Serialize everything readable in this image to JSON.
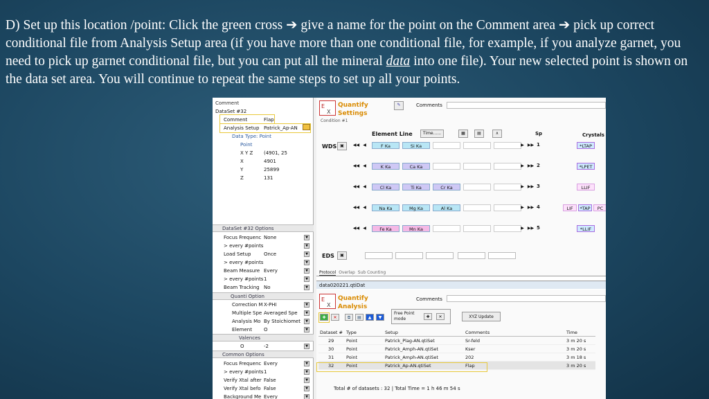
{
  "slide": {
    "text_a": "D) Set up this location /point:  Click the green cross ",
    "arrow1": "➔",
    "text_b": " give a name for the point on the Comment area ",
    "arrow2": "➔",
    "text_c": " pick up correct conditional file  from Analysis Setup area (if you have more than one conditional file, for example, if you analyze garnet, you need to pick up garnet conditional file, but you can put all the mineral ",
    "data_word": "data",
    "text_d": " into one file). Your new selected point is shown on the data set area.  You will continue to repeat the same steps to set up all your points."
  },
  "tree": {
    "comment_header": "Comment",
    "dataset": "DataSet #32",
    "comment_label": "Comment",
    "comment_value": "Flap",
    "analysis_label": "Analysis Setup",
    "analysis_value": "Patrick_Ap-AN",
    "data_type": "Data Type: Point",
    "point": "Point",
    "xyz_label": "X Y Z",
    "xyz_value": "(4901, 25",
    "x_label": "X",
    "x_value": "4901",
    "y_label": "Y",
    "y_value": "25899",
    "z_label": "Z",
    "z_value": "131"
  },
  "options": {
    "header": "DataSet #32 Options",
    "rows": [
      {
        "k": "Focus Frequenc",
        "v": "None"
      },
      {
        "k": "> every #points",
        "v": ""
      },
      {
        "k": "Load Setup",
        "v": "Once"
      },
      {
        "k": "> every #points",
        "v": ""
      },
      {
        "k": "Beam Measure",
        "v": "Every"
      },
      {
        "k": "> every #points",
        "v": "1"
      },
      {
        "k": "Beam Tracking",
        "v": "No"
      }
    ],
    "quanti_header": "Quanti  Option",
    "quanti_rows": [
      {
        "k": "Correction M",
        "v": "X-PHI"
      },
      {
        "k": "Multiple Spe",
        "v": "Averaged Spe"
      },
      {
        "k": "Analysis Mo",
        "v": "By Stoichiomet"
      },
      {
        "k": "Element",
        "v": "O"
      }
    ],
    "valence_header": "Valences",
    "valence_row": {
      "k": "O",
      "v": "-2"
    },
    "common_header": "Common Options",
    "common_rows": [
      {
        "k": "Focus Frequenc",
        "v": "Every"
      },
      {
        "k": "> every #points",
        "v": "1"
      },
      {
        "k": "Verify Xtal after",
        "v": "False"
      },
      {
        "k": "Verify Xtal befo",
        "v": "False"
      },
      {
        "k": "Background Me",
        "v": "Every"
      }
    ]
  },
  "quantify": {
    "title1": "Quantify",
    "title2": "Settings",
    "comments_label": "Comments",
    "condition": "Condition #1",
    "element_line": "Element Line",
    "time_btn": "Time......",
    "sp_label": "Sp",
    "crystals_label": "Crystals",
    "wds_label": "WDS",
    "eds_label": "EDS",
    "rows": [
      {
        "sp": "1",
        "els": [
          "F Ka",
          "Si Ka"
        ],
        "crystals": [
          "*LTAP"
        ]
      },
      {
        "sp": "2",
        "els": [
          "K Ka",
          "Ca Ka"
        ],
        "crystals": [
          "*LPET"
        ]
      },
      {
        "sp": "3",
        "els": [
          "Cl Ka",
          "Ti Ka",
          "Cr Ka"
        ],
        "crystals": [
          "LLIF"
        ]
      },
      {
        "sp": "4",
        "els": [
          "Na Ka",
          "Mg Ka",
          "Al Ka"
        ],
        "crystals": [
          "LIF",
          "*TAP",
          "PC"
        ]
      },
      {
        "sp": "5",
        "els": [
          "Fe Ka",
          "Mn Ka"
        ],
        "crystals": [
          "*LLIF"
        ]
      }
    ],
    "tabs": [
      "Protocol",
      "Overlap",
      "Sub Counting"
    ],
    "file": "data020221.qtiDat"
  },
  "analysis": {
    "title1": "Quantify",
    "title2": "Analysis",
    "comments_label": "Comments",
    "free_point": "Free Point mode",
    "xyz_update": "XYZ Update",
    "columns": [
      "Dataset #",
      "Type",
      "Setup",
      "Comments",
      "Time"
    ],
    "rows": [
      [
        "29",
        "Point",
        "Patrick_Plag-AN.qtiSet",
        "Sr-feld",
        "3 m 20 s"
      ],
      [
        "30",
        "Point",
        "Patrick_Amph-AN.qtiSet",
        "Kser",
        "3 m 20 s"
      ],
      [
        "31",
        "Point",
        "Patrick_Amph-AN.qtiSet",
        "202",
        "3 m 18 s"
      ],
      [
        "32",
        "Point",
        "Patrick_Ap-AN.qtiSet",
        "Flap",
        "3 m 20 s"
      ]
    ],
    "total": "Total # of datasets : 32  | Total Time = 1 h 46 m 54 s"
  },
  "colors": {
    "highlight": "#e8c83a",
    "element_blue": "#b8e6f5",
    "element_purple": "#cfc8f5",
    "element_pink": "#f5b9e6",
    "title_orange": "#d98a00"
  }
}
